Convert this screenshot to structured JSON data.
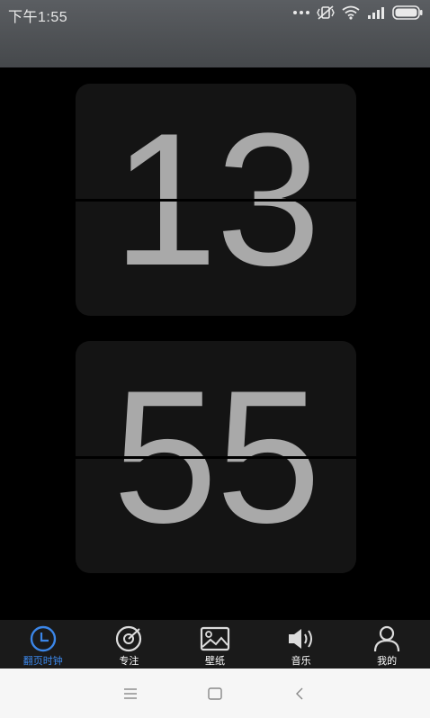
{
  "status_bar": {
    "time": "下午1:55"
  },
  "clock": {
    "hour": "13",
    "minute": "55"
  },
  "bottom_nav": {
    "items": [
      {
        "label": "翻页时钟",
        "icon": "clock-icon",
        "active": true
      },
      {
        "label": "专注",
        "icon": "focus-icon",
        "active": false
      },
      {
        "label": "壁纸",
        "icon": "image-icon",
        "active": false
      },
      {
        "label": "音乐",
        "icon": "speaker-icon",
        "active": false
      },
      {
        "label": "我的",
        "icon": "user-icon",
        "active": false
      }
    ]
  },
  "colors": {
    "accent": "#3b86e8",
    "card": "#141414",
    "digit": "#a9a9a9",
    "status_bar": "#505356"
  }
}
